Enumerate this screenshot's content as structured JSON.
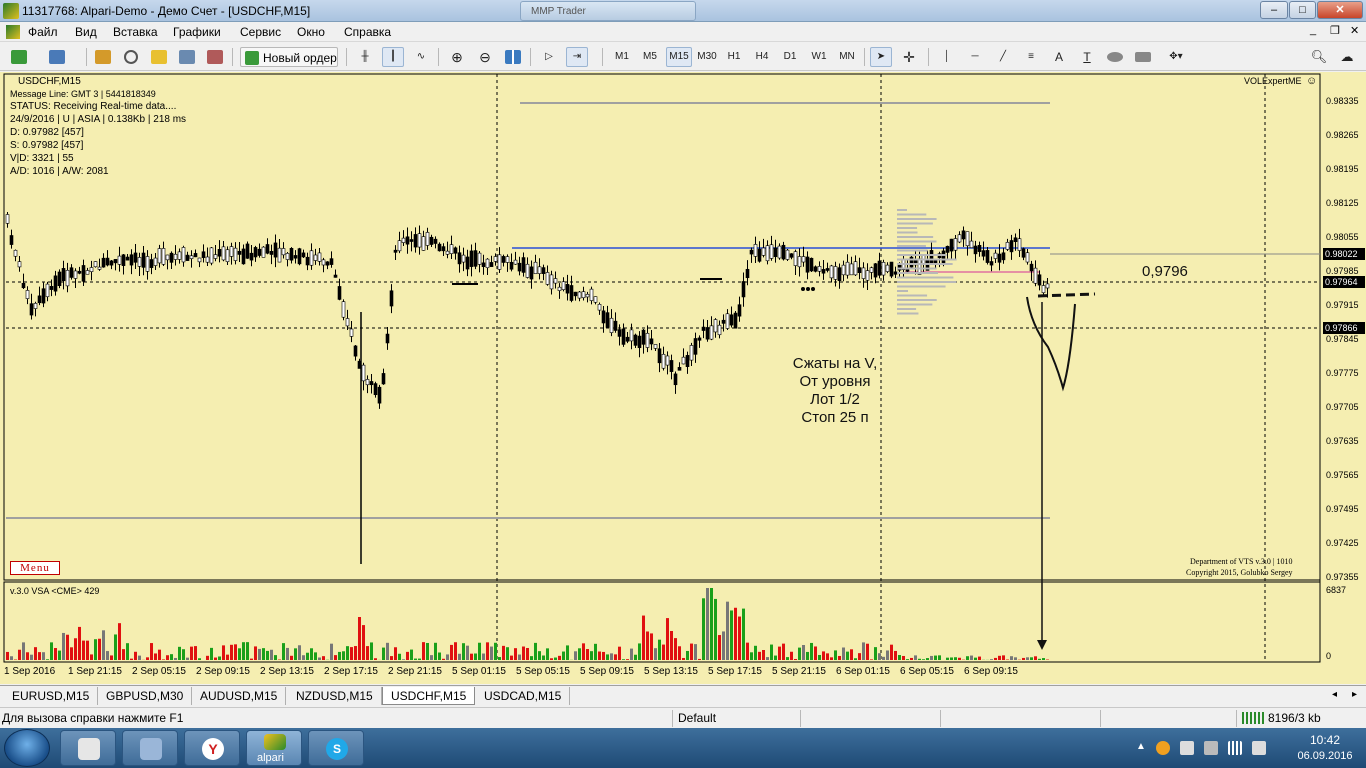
{
  "window": {
    "title": "11317768: Alpari-Demo - Демо Счет - [USDCHF,M15]",
    "background_tab": "MMP Trader",
    "controls": [
      "–",
      "□",
      "✕"
    ]
  },
  "menu": {
    "items": [
      "Файл",
      "Вид",
      "Вставка",
      "Графики",
      "Сервис",
      "Окно",
      "Справка"
    ]
  },
  "toolbar": {
    "new_order_label": "Новый ордер",
    "timeframes": [
      "M1",
      "M5",
      "M15",
      "M30",
      "H1",
      "H4",
      "D1",
      "W1",
      "MN"
    ],
    "active_timeframe": "M15",
    "text_tool": "A"
  },
  "chart": {
    "symbol_header": "USDCHF,M15",
    "info_lines": [
      "Message Line: GMT 3 | 5441818349",
      "STATUS:  Receiving Real-time data....",
      "24/9/2016 | U | ASIA | 0.138Kb | 218 ms",
      "D: 0.97982  [457]",
      "S: 0.97982  [457]",
      "V|D: 3321 | 55",
      "A/D: 1016 | A/W: 2081"
    ],
    "expert_label": "VOLExpertME",
    "menu_button": "Menu",
    "copyright_lines": [
      "Department of VTS  v.3.0 | 1010",
      "Copyright 2015, Golubko Sergey"
    ],
    "annotation_lines": [
      "Сжаты на V,",
      "От уровня",
      "Лот 1/2",
      "Стоп 25 п"
    ],
    "level_note": "0,9796",
    "price_axis": [
      "0.98335",
      "0.98265",
      "0.98195",
      "0.98125",
      "0.98055",
      "0.97985",
      "0.97915",
      "0.97845",
      "0.97775",
      "0.97705",
      "0.97635",
      "0.97565",
      "0.97495",
      "0.97425",
      "0.97355"
    ],
    "price_boxes": [
      "0.98022",
      "0.97964",
      "0.97866"
    ],
    "indicator_label": "v.3.0 VSA <CME> 429",
    "indicator_axis_top": "6837",
    "indicator_axis_bottom": "0",
    "time_axis": [
      "1 Sep 2016",
      "1 Sep 21:15",
      "2 Sep 05:15",
      "2 Sep 09:15",
      "2 Sep 13:15",
      "2 Sep 17:15",
      "2 Sep 21:15",
      "5 Sep 01:15",
      "5 Sep 05:15",
      "5 Sep 09:15",
      "5 Sep 13:15",
      "5 Sep 17:15",
      "5 Sep 21:15",
      "6 Sep 01:15",
      "6 Sep 05:15",
      "6 Sep 09:15"
    ]
  },
  "symbol_tabs": [
    "EURUSD,M15",
    "GBPUSD,M30",
    "AUDUSD,M15",
    "NZDUSD,M15",
    "USDCHF,M15",
    "USDCAD,M15"
  ],
  "active_symbol_tab": "USDCHF,M15",
  "status": {
    "help_text": "Для вызова справки нажмите F1",
    "profile": "Default",
    "traffic": "8196/3 kb"
  },
  "taskbar": {
    "alpari_label": "alpari",
    "time": "10:42",
    "date": "06.09.2016"
  },
  "colors": {
    "chart_background": "#f5eeb1",
    "bull_bar": "#1aa01a",
    "bear_bar": "#e01010",
    "resistance_line": "#2a4fd8",
    "price_box": "#000000"
  }
}
